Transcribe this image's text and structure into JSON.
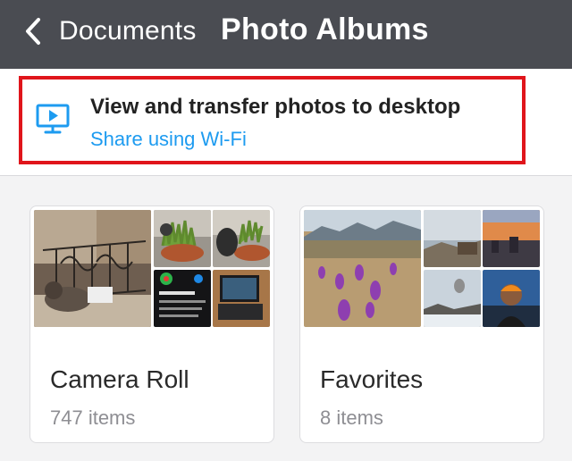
{
  "nav": {
    "back_label": "Documents",
    "title": "Photo Albums"
  },
  "banner": {
    "title": "View and transfer photos to desktop",
    "link": "Share using Wi-Fi",
    "icon": "desktop-play-icon"
  },
  "albums": [
    {
      "name": "Camera Roll",
      "count": "747 items"
    },
    {
      "name": "Favorites",
      "count": "8 items"
    }
  ],
  "colors": {
    "nav_bg": "#4a4c52",
    "accent": "#1d9bf0",
    "highlight": "#e0151b",
    "page_bg": "#f3f3f4"
  }
}
